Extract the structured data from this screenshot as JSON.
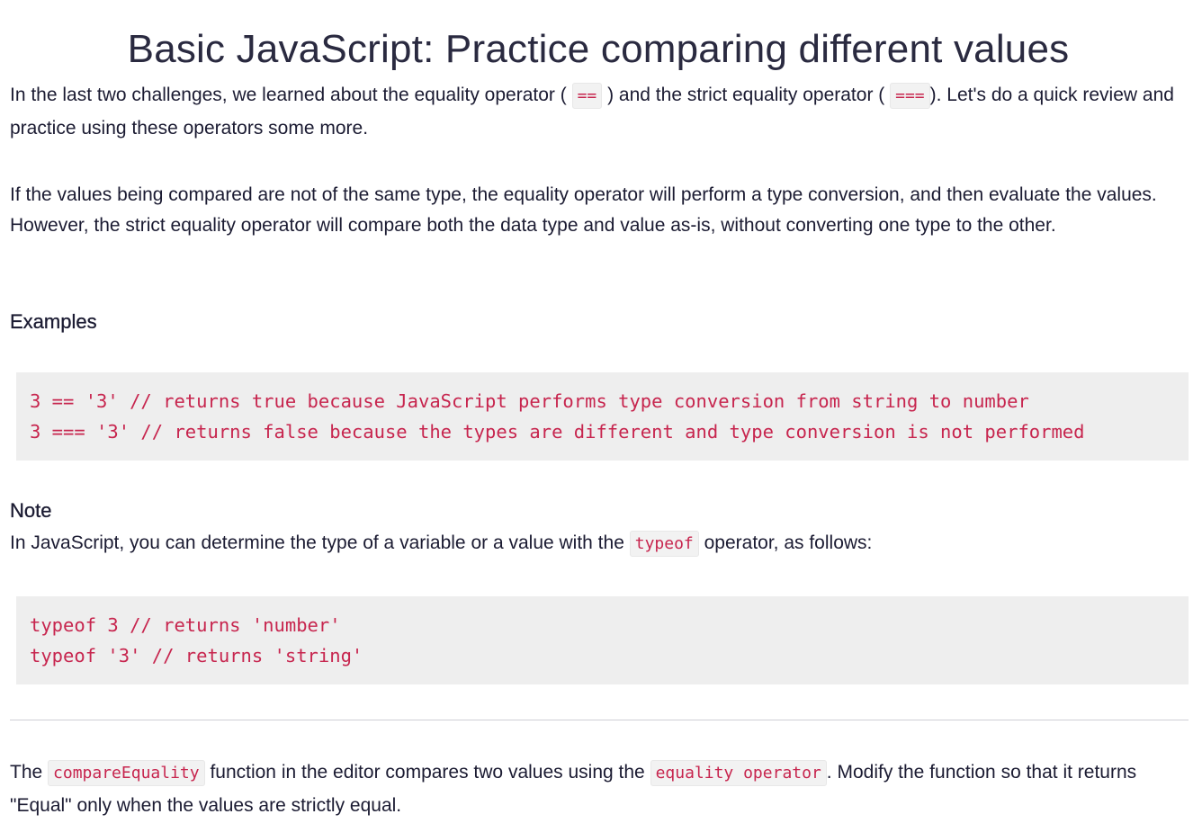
{
  "title": "Basic JavaScript: Practice comparing different values",
  "intro": {
    "text_1": "In the last two challenges, we learned about the equality operator (",
    "code_1": "==",
    "text_2": ") and the strict equality operator (",
    "code_2": "===",
    "text_3": "). Let's do a quick review and practice using these operators some more."
  },
  "explanation": "If the values being compared are not of the same type, the equality operator will perform a type conversion, and then evaluate the values. However, the strict equality operator will compare both the data type and value as-is, without converting one type to the other.",
  "examples": {
    "heading": "Examples",
    "lines": [
      "3 == '3' // returns true because JavaScript performs type conversion from string to number",
      "3 === '3' // returns false because the types are different and type conversion is not performed"
    ]
  },
  "note": {
    "heading": "Note",
    "text_1": "In JavaScript, you can determine the type of a variable or a value with the",
    "code": "typeof",
    "text_2": "operator, as follows:",
    "lines": [
      "typeof 3 // returns 'number'",
      "typeof '3' // returns 'string'"
    ]
  },
  "instructions": {
    "text_1": "The",
    "code_1": "compareEquality",
    "text_2": "function in the editor compares two values using the",
    "code_2": "equality operator",
    "text_3": ". Modify the function so that it returns \"Equal\" only when the values are strictly equal."
  },
  "colors": {
    "code_text": "#c7254e",
    "code_background": "#eeeeee",
    "body_text": "#1b1b32"
  }
}
